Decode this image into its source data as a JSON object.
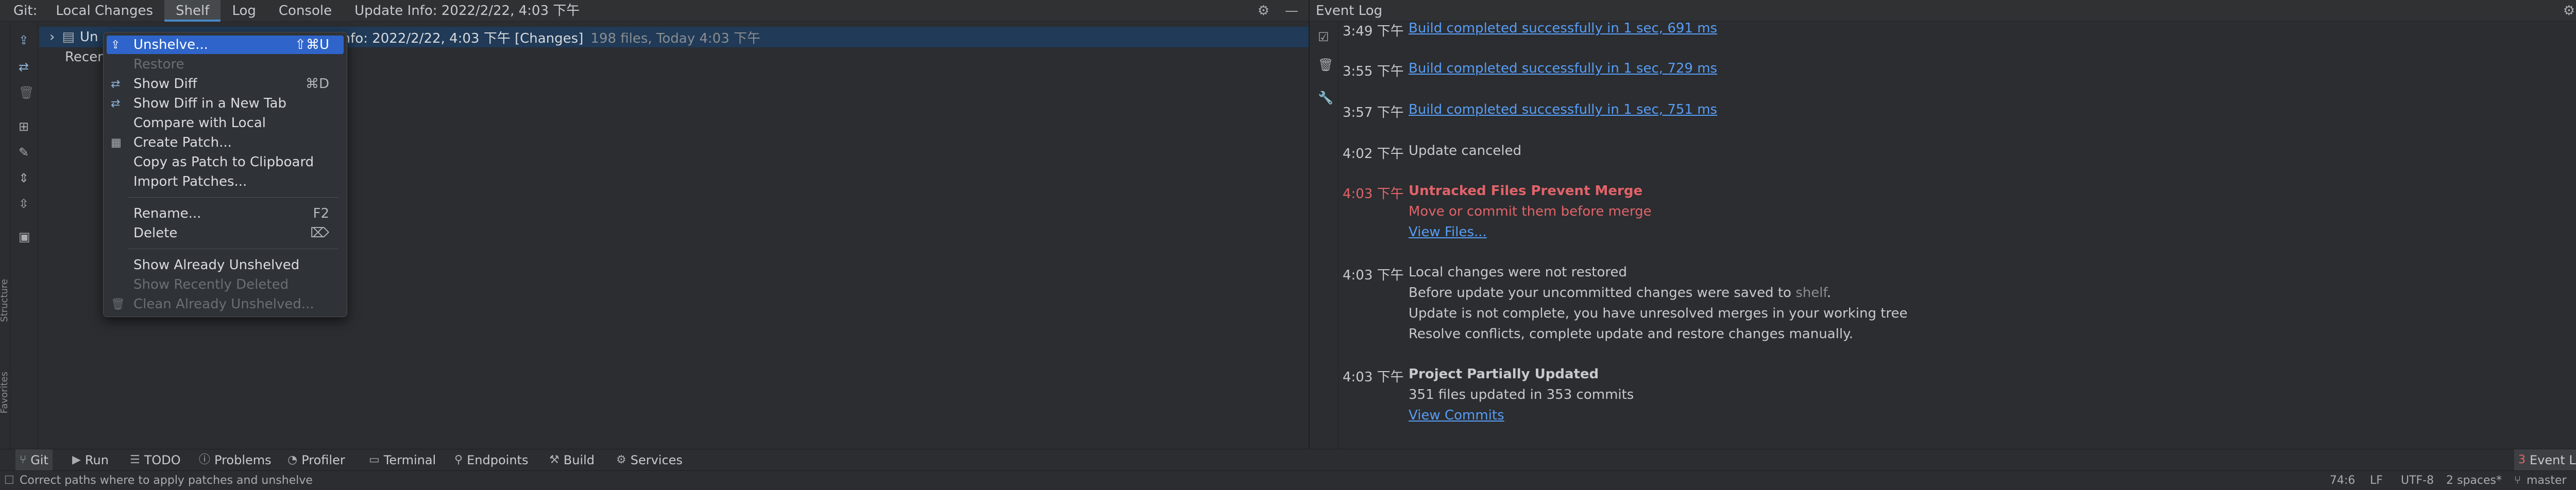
{
  "git_header": {
    "title": "Git:",
    "tabs": [
      {
        "label": "Local Changes",
        "active": false
      },
      {
        "label": "Shelf",
        "active": true
      },
      {
        "label": "Log",
        "active": false
      },
      {
        "label": "Console",
        "active": false
      },
      {
        "label": "Update Info: 2022/2/22, 4:03 下午",
        "active": false
      }
    ],
    "icons": [
      "gear-icon",
      "minimize-icon"
    ]
  },
  "left_strip": {
    "vertical_labels": [
      "Structure",
      "Favorites"
    ]
  },
  "git_toolbar": {
    "icons": [
      "unshelve-icon",
      "show-diff-icon",
      "delete-icon",
      "group-by-icon",
      "clean-icon",
      "expand-all-icon",
      "collapse-all-icon",
      "preview-icon"
    ]
  },
  "shelf": {
    "row": {
      "name_prefix": "Un",
      "name_rest": "... Update Info: 2022/2/22, 4:03 下午 [Changes]",
      "meta": "198 files, Today 4:03 下午"
    },
    "recent_label": "Recen"
  },
  "context_menu": {
    "items": [
      {
        "label": "Unshelve...",
        "shortcut": "⇧⌘U",
        "icon": "unshelve-icon",
        "selected": true,
        "disabled": false
      },
      {
        "label": "Restore",
        "shortcut": "",
        "icon": "",
        "selected": false,
        "disabled": true
      },
      {
        "label": "Show Diff",
        "shortcut": "⌘D",
        "icon": "diff-icon",
        "selected": false,
        "disabled": false
      },
      {
        "label": "Show Diff in a New Tab",
        "shortcut": "",
        "icon": "diff-tab-icon",
        "selected": false,
        "disabled": false
      },
      {
        "label": "Compare with Local",
        "shortcut": "",
        "icon": "",
        "selected": false,
        "disabled": false
      },
      {
        "label": "Create Patch...",
        "shortcut": "",
        "icon": "patch-icon",
        "selected": false,
        "disabled": false
      },
      {
        "label": "Copy as Patch to Clipboard",
        "shortcut": "",
        "icon": "",
        "selected": false,
        "disabled": false
      },
      {
        "label": "Import Patches...",
        "shortcut": "",
        "icon": "",
        "selected": false,
        "disabled": false
      },
      {
        "label": "Rename...",
        "shortcut": "F2",
        "icon": "",
        "selected": false,
        "disabled": false
      },
      {
        "label": "Delete",
        "shortcut": "⌦",
        "icon": "",
        "selected": false,
        "disabled": false
      },
      {
        "label": "Show Already Unshelved",
        "shortcut": "",
        "icon": "",
        "selected": false,
        "disabled": false
      },
      {
        "label": "Show Recently Deleted",
        "shortcut": "",
        "icon": "",
        "selected": false,
        "disabled": true
      },
      {
        "label": "Clean Already Unshelved...",
        "shortcut": "",
        "icon": "trash-icon",
        "selected": false,
        "disabled": true
      }
    ]
  },
  "event_log": {
    "title": "Event Log",
    "icons": [
      "gear-icon",
      "minimize-icon"
    ],
    "toolbar_icons": [
      "mark-read-icon",
      "clear-icon",
      "settings-wrench-icon"
    ],
    "entries": [
      {
        "time": "3:49 下午",
        "lines": [
          {
            "text": "Build completed successfully in 1 sec, 691 ms",
            "style": "link"
          }
        ]
      },
      {
        "time": "3:55 下午",
        "lines": [
          {
            "text": "Build completed successfully in 1 sec, 729 ms",
            "style": "link"
          }
        ]
      },
      {
        "time": "3:57 下午",
        "lines": [
          {
            "text": "Build completed successfully in 1 sec, 751 ms",
            "style": "link"
          }
        ]
      },
      {
        "time": "4:02 下午",
        "lines": [
          {
            "text": "Update canceled",
            "style": "plain"
          }
        ]
      },
      {
        "time": "4:03 下午",
        "time_style": "red",
        "lines": [
          {
            "text": "Untracked Files Prevent Merge",
            "style": "red-bold"
          },
          {
            "text": "Move or commit them before merge",
            "style": "red"
          },
          {
            "text": "View Files...",
            "style": "link"
          }
        ]
      },
      {
        "time": "4:03 下午",
        "lines": [
          {
            "text": "Local changes were not restored",
            "style": "plain"
          },
          {
            "text_before": "Before update your uncommitted changes were saved to ",
            "text_link": "shelf",
            "text_after": ".",
            "style": "mixed"
          },
          {
            "text": "Update is not complete, you have unresolved merges in your working tree",
            "style": "plain"
          },
          {
            "text": "Resolve conflicts, complete update and restore changes manually.",
            "style": "plain"
          }
        ]
      },
      {
        "time": "4:03 下午",
        "lines": [
          {
            "text": "Project Partially Updated",
            "style": "bold"
          },
          {
            "text": "351 files updated in 353 commits",
            "style": "plain"
          },
          {
            "text": "View Commits",
            "style": "link"
          }
        ]
      }
    ],
    "scroll_marks": [
      {
        "color": "#e2636a"
      },
      {
        "color": "#6aab73"
      }
    ]
  },
  "bottom_bar": {
    "buttons": [
      {
        "label": "Git",
        "icon": "git-branch-icon",
        "active": true
      },
      {
        "label": "Run",
        "icon": "run-icon",
        "active": false
      },
      {
        "label": "TODO",
        "icon": "todo-icon",
        "active": false
      },
      {
        "label": "Problems",
        "icon": "problems-icon",
        "active": false
      },
      {
        "label": "Profiler",
        "icon": "profiler-icon",
        "active": false
      },
      {
        "label": "Terminal",
        "icon": "terminal-icon",
        "active": false
      },
      {
        "label": "Endpoints",
        "icon": "endpoints-icon",
        "active": false
      },
      {
        "label": "Build",
        "icon": "build-icon",
        "active": false
      },
      {
        "label": "Services",
        "icon": "services-icon",
        "active": false
      }
    ],
    "event_log": {
      "label": "Event Log",
      "badge": "3"
    }
  },
  "status_bar": {
    "message": "Correct paths where to apply patches and unshelve",
    "position": "74:6",
    "line_sep": "LF",
    "encoding": "UTF-8",
    "indent": "2 spaces*",
    "branch": "master"
  }
}
